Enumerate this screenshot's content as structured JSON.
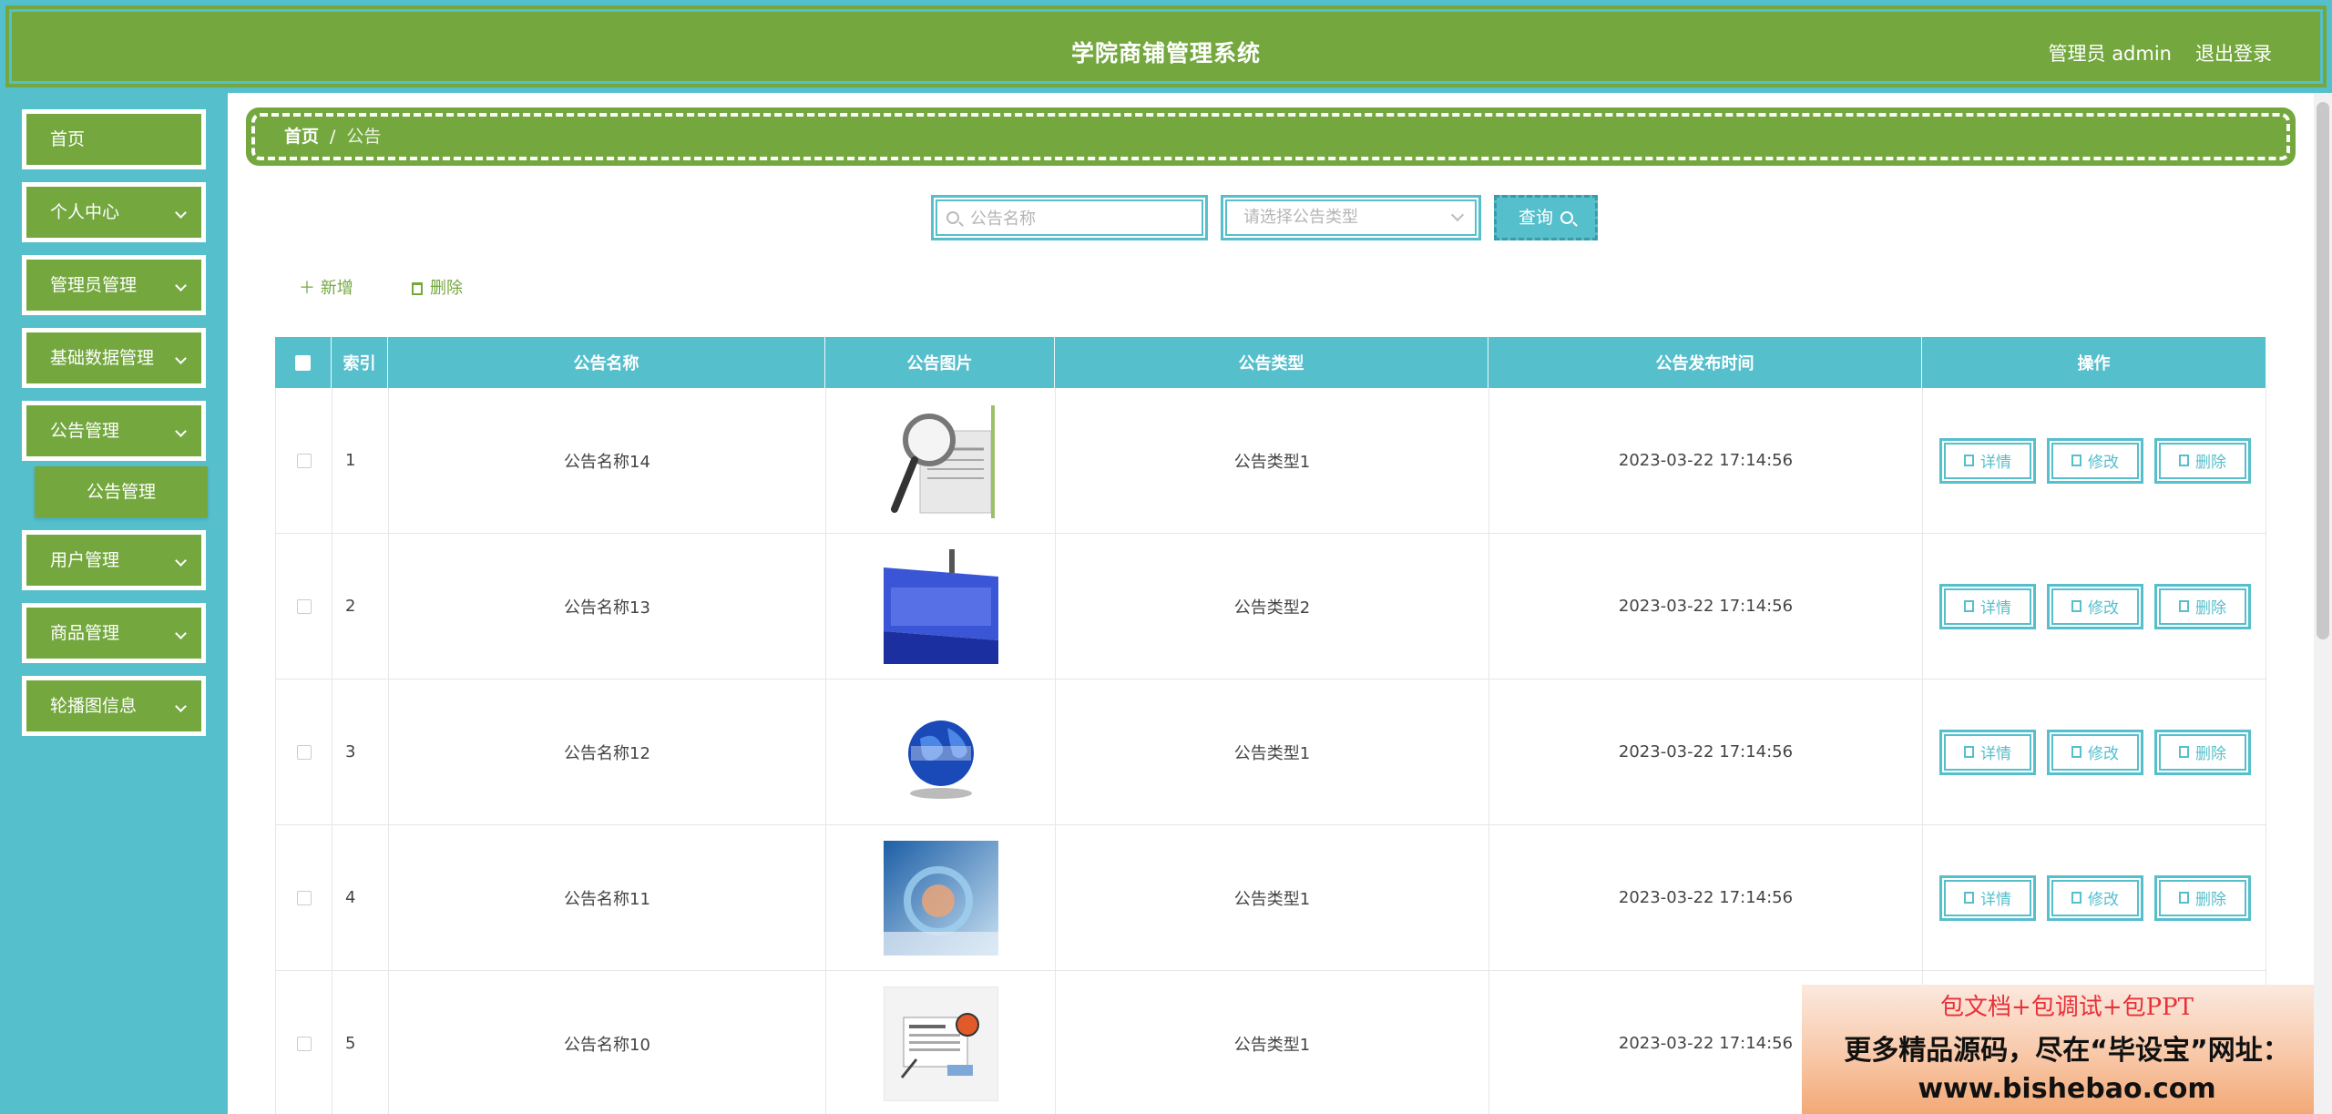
{
  "header": {
    "title": "学院商铺管理系统",
    "user": "管理员 admin",
    "logout": "退出登录"
  },
  "sidebar": {
    "items": [
      {
        "label": "首页"
      },
      {
        "label": "个人中心"
      },
      {
        "label": "管理员管理"
      },
      {
        "label": "基础数据管理"
      },
      {
        "label": "公告管理"
      },
      {
        "label": "用户管理"
      },
      {
        "label": "商品管理"
      },
      {
        "label": "轮播图信息"
      }
    ],
    "submenu": {
      "label": "公告管理"
    }
  },
  "breadcrumb": {
    "home": "首页",
    "separator": "/",
    "current": "公告"
  },
  "search": {
    "name_placeholder": "公告名称",
    "type_placeholder": "请选择公告类型",
    "query_label": "查询"
  },
  "actions": {
    "add": "新增",
    "delete": "删除"
  },
  "table": {
    "headers": [
      "索引",
      "公告名称",
      "公告图片",
      "公告类型",
      "公告发布时间",
      "操作"
    ],
    "rows": [
      {
        "index": "1",
        "name": "公告名称14",
        "type": "公告类型1",
        "time": "2023-03-22 17:14:56"
      },
      {
        "index": "2",
        "name": "公告名称13",
        "type": "公告类型2",
        "time": "2023-03-22 17:14:56"
      },
      {
        "index": "3",
        "name": "公告名称12",
        "type": "公告类型1",
        "time": "2023-03-22 17:14:56"
      },
      {
        "index": "4",
        "name": "公告名称11",
        "type": "公告类型1",
        "time": "2023-03-22 17:14:56"
      },
      {
        "index": "5",
        "name": "公告名称10",
        "type": "公告类型1",
        "time": "2023-03-22 17:14:56"
      }
    ],
    "row_actions": {
      "detail": "详情",
      "edit": "修改",
      "delete": "删除"
    }
  },
  "ad": {
    "line1": "包文档+包调试+包PPT",
    "line2": "更多精品源码，尽在“毕设宝”网址：",
    "line3": "www.bishebao.com"
  },
  "colors": {
    "green": "#74a83f",
    "teal": "#56bfcc"
  }
}
